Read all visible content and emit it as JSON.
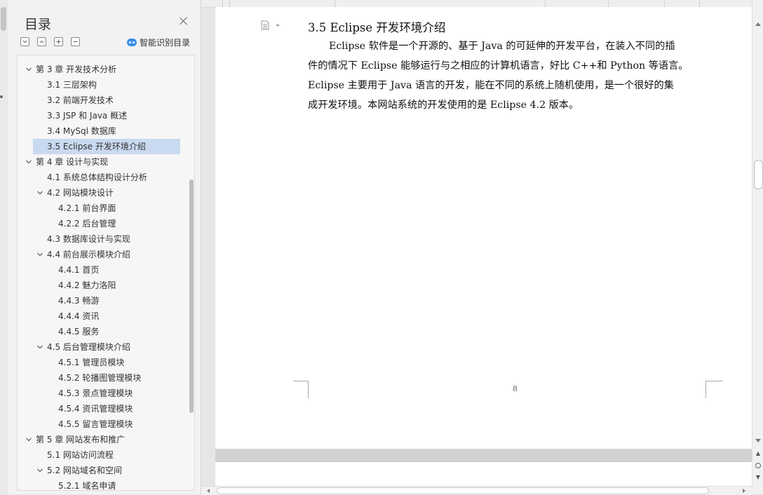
{
  "toc": {
    "title": "目录",
    "smart_label": "智能识别目录",
    "items": [
      {
        "label": "第 3 章  开发技术分析",
        "level": 1,
        "expanded": true
      },
      {
        "label": "3.1  三层架构",
        "level": 2
      },
      {
        "label": "3.2  前端开发技术",
        "level": 2
      },
      {
        "label": "3.3 JSP 和 Java 概述",
        "level": 2
      },
      {
        "label": "3.4 MySql 数据库",
        "level": 2
      },
      {
        "label": "3.5 Eclipse  开发环境介绍",
        "level": 2,
        "selected": true
      },
      {
        "label": "第 4 章  设计与实现",
        "level": 1,
        "expanded": true
      },
      {
        "label": "4.1  系统总体结构设计分析",
        "level": 2
      },
      {
        "label": "4.2  网站模块设计",
        "level": 2,
        "expanded": true
      },
      {
        "label": "4.2.1  前台界面",
        "level": 3
      },
      {
        "label": "4.2.2  后台管理",
        "level": 3
      },
      {
        "label": "4.3  数据库设计与实现",
        "level": 2
      },
      {
        "label": "4.4  前台展示模块介绍",
        "level": 2,
        "expanded": true
      },
      {
        "label": "4.4.1  首页",
        "level": 3
      },
      {
        "label": "4.4.2  魅力洛阳",
        "level": 3
      },
      {
        "label": "4.4.3  畅游",
        "level": 3
      },
      {
        "label": "4.4.4  资讯",
        "level": 3
      },
      {
        "label": "4.4.5  服务",
        "level": 3
      },
      {
        "label": "4.5  后台管理模块介绍",
        "level": 2,
        "expanded": true
      },
      {
        "label": "4.5.1  管理员模块",
        "level": 3
      },
      {
        "label": "4.5.2  轮播图管理模块",
        "level": 3
      },
      {
        "label": "4.5.3  景点管理模块",
        "level": 3
      },
      {
        "label": "4.5.4  资讯管理模块",
        "level": 3
      },
      {
        "label": "4.5.5  留言管理模块",
        "level": 3
      },
      {
        "label": "第 5 章  网站发布和推广",
        "level": 1,
        "expanded": true
      },
      {
        "label": "5.1  网站访问流程",
        "level": 2
      },
      {
        "label": "5.2  网站域名和空间",
        "level": 2,
        "expanded": true
      },
      {
        "label": "5.2.1  域名申请",
        "level": 3
      }
    ]
  },
  "document": {
    "heading": "3.5 Eclipse 开发环境介绍",
    "lines": [
      "Eclipse 软件是一个开源的、基于 Java 的可延伸的开发平台，在装入不同的插",
      "件的情况下 Eclipse 能够运行与之相应的计算机语言，好比 C++和 Python 等语言。",
      "Eclipse 主要用于 Java 语言的开发，能在不同的系统上随机使用，是一个很好的集",
      "成开发环境。本网站系统的开发使用的是 Eclipse 4.2 版本。"
    ],
    "page_number": "8"
  },
  "colors": {
    "selection": "#c9d9f0",
    "accent": "#3a8ee6"
  }
}
